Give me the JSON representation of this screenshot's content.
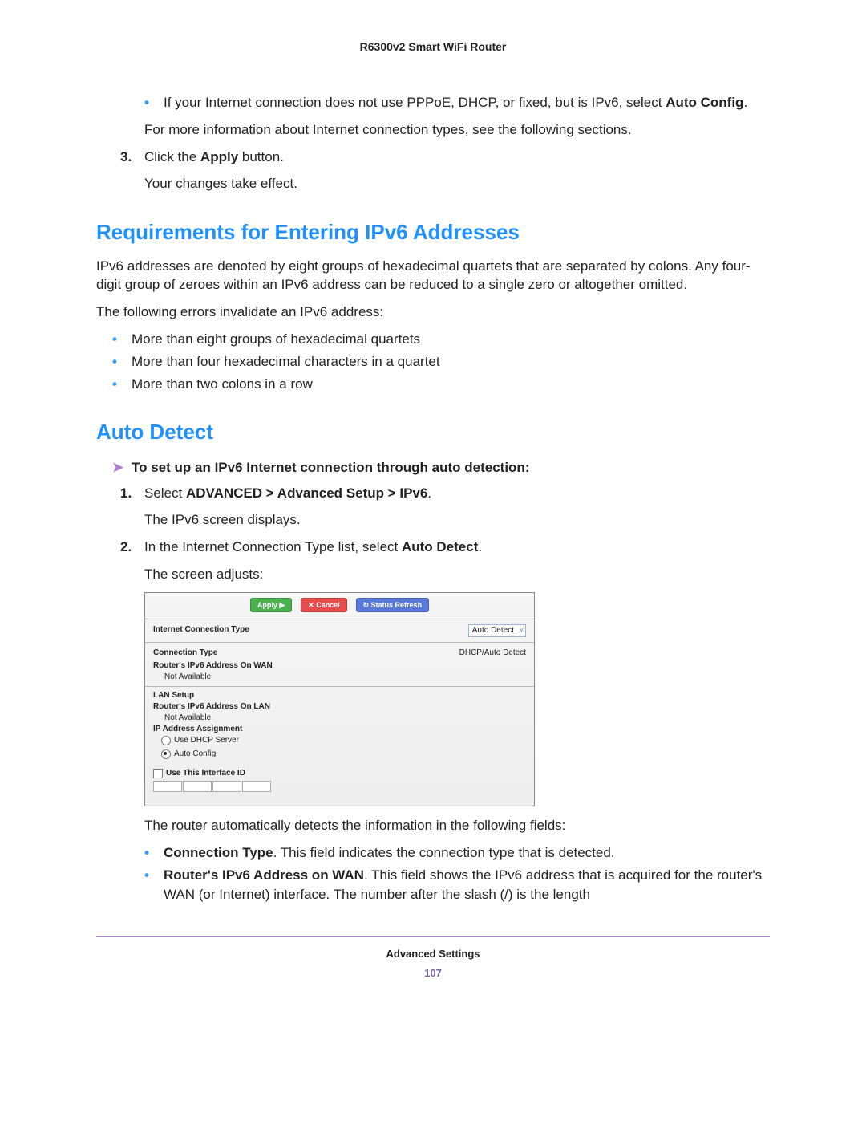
{
  "doc_title": "R6300v2 Smart WiFi Router",
  "intro_bullet": {
    "prefix": "If your Internet connection does not use PPPoE, DHCP, or fixed, but is IPv6, select ",
    "bold": "Auto Config",
    "suffix": "."
  },
  "intro_more": "For more information about Internet connection types, see the following sections.",
  "step3": {
    "num": "3.",
    "prefix": "Click the ",
    "bold": "Apply",
    "suffix": " button."
  },
  "step3_result": "Your changes take effect.",
  "h_req": "Requirements for Entering IPv6 Addresses",
  "req_para": "IPv6 addresses are denoted by eight groups of hexadecimal quartets that are separated by colons. Any four-digit group of zeroes within an IPv6 address can be reduced to a single zero or altogether omitted.",
  "req_errors_intro": "The following errors invalidate an IPv6 address:",
  "req_errors": [
    "More than eight groups of hexadecimal quartets",
    "More than four hexadecimal characters in a quartet",
    "More than two colons in a row"
  ],
  "h_auto": "Auto Detect",
  "auto_task": "To set up an IPv6 Internet connection through auto detection:",
  "auto_step1": {
    "num": "1.",
    "prefix": "Select ",
    "bold": "ADVANCED > Advanced Setup > IPv6",
    "suffix": "."
  },
  "auto_step1_res": "The IPv6 screen displays.",
  "auto_step2": {
    "num": "2.",
    "prefix": "In the Internet Connection Type list, select ",
    "bold": "Auto Detect",
    "suffix": "."
  },
  "auto_step2_res": "The screen adjusts:",
  "ui": {
    "apply": "Apply ▶",
    "cancel": "✕ Cancel",
    "refresh": "↻ Status Refresh",
    "ict_label": "Internet Connection Type",
    "ict_value": "Auto Detect",
    "conn_type_label": "Connection Type",
    "conn_type_value": "DHCP/Auto Detect",
    "wan_label": "Router's IPv6 Address On WAN",
    "not_avail": "Not Available",
    "lan_setup": "LAN Setup",
    "lan_addr": "Router's IPv6 Address On LAN",
    "ip_assign": "IP Address Assignment",
    "use_dhcp": "Use DHCP Server",
    "auto_config": "Auto Config",
    "use_iface": "Use This Interface ID"
  },
  "after_ui": "The router automatically detects the information in the following fields:",
  "field1": {
    "bold": "Connection Type",
    "text": ". This field indicates the connection type that is detected."
  },
  "field2": {
    "bold": "Router's IPv6 Address on WAN",
    "text": ". This field shows the IPv6 address that is acquired for the router's WAN (or Internet) interface. The number after the slash (/) is the length"
  },
  "footer_section": "Advanced Settings",
  "footer_page": "107"
}
